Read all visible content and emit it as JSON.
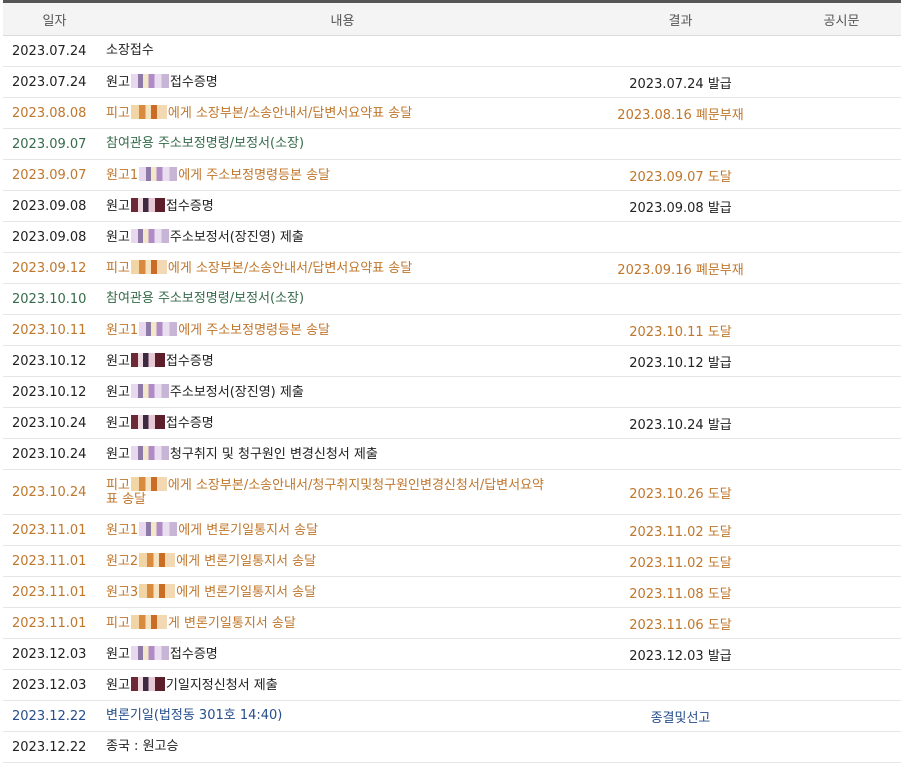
{
  "header": {
    "date": "일자",
    "content": "내용",
    "result": "결과",
    "notice": "공시문"
  },
  "rows": [
    {
      "date": "2023.07.24",
      "content_a": "소장접수",
      "content_b": "",
      "result": "",
      "color": "black",
      "redact": ""
    },
    {
      "date": "2023.07.24",
      "content_a": "원고",
      "content_b": "접수증명",
      "result": "2023.07.24 발급",
      "color": "black",
      "redact": "normal"
    },
    {
      "date": "2023.08.08",
      "content_a": "피고",
      "content_b": "에게 소장부본/소송안내서/답변서요약표 송달",
      "result": "2023.08.16 폐문부재",
      "color": "orange",
      "redact": "warm"
    },
    {
      "date": "2023.09.07",
      "content_a": "참여관용 주소보정명령/보정서(소장)",
      "content_b": "",
      "result": "",
      "color": "green",
      "redact": ""
    },
    {
      "date": "2023.09.07",
      "content_a": "원고1",
      "content_b": "에게 주소보정명령등본 송달",
      "result": "2023.09.07 도달",
      "color": "orange",
      "redact": "normal"
    },
    {
      "date": "2023.09.08",
      "content_a": "원고",
      "content_b": "접수증명",
      "result": "2023.09.08 발급",
      "color": "black",
      "redact": "dark"
    },
    {
      "date": "2023.09.08",
      "content_a": "원고",
      "content_b": "주소보정서(장진영) 제출",
      "result": "",
      "color": "black",
      "redact": "normal"
    },
    {
      "date": "2023.09.12",
      "content_a": "피고",
      "content_b": "에게 소장부본/소송안내서/답변서요약표 송달",
      "result": "2023.09.16 폐문부재",
      "color": "orange",
      "redact": "warm"
    },
    {
      "date": "2023.10.10",
      "content_a": "참여관용 주소보정명령/보정서(소장)",
      "content_b": "",
      "result": "",
      "color": "green",
      "redact": ""
    },
    {
      "date": "2023.10.11",
      "content_a": "원고1",
      "content_b": "에게 주소보정명령등본 송달",
      "result": "2023.10.11 도달",
      "color": "orange",
      "redact": "normal"
    },
    {
      "date": "2023.10.12",
      "content_a": "원고",
      "content_b": "접수증명",
      "result": "2023.10.12 발급",
      "color": "black",
      "redact": "dark"
    },
    {
      "date": "2023.10.12",
      "content_a": "원고",
      "content_b": "주소보정서(장진영) 제출",
      "result": "",
      "color": "black",
      "redact": "normal"
    },
    {
      "date": "2023.10.24",
      "content_a": "원고",
      "content_b": "접수증명",
      "result": "2023.10.24 발급",
      "color": "black",
      "redact": "dark"
    },
    {
      "date": "2023.10.24",
      "content_a": "원고",
      "content_b": "청구취지 및 청구원인 변경신청서 제출",
      "result": "",
      "color": "black",
      "redact": "normal"
    },
    {
      "date": "2023.10.24",
      "content_a": "피고",
      "content_b": "에게 소장부본/소송안내서/청구취지및청구원인변경신청서/답변서요약",
      "content_c": "표 송달",
      "result": "2023.10.26 도달",
      "color": "orange",
      "redact": "warm",
      "tall": true
    },
    {
      "date": "2023.11.01",
      "content_a": "원고1",
      "content_b": "에게 변론기일통지서 송달",
      "result": "2023.11.02 도달",
      "color": "orange",
      "redact": "normal"
    },
    {
      "date": "2023.11.01",
      "content_a": "원고2",
      "content_b": "에게 변론기일통지서 송달",
      "result": "2023.11.02 도달",
      "color": "orange",
      "redact": "warm"
    },
    {
      "date": "2023.11.01",
      "content_a": "원고3",
      "content_b": "에게 변론기일통지서 송달",
      "result": "2023.11.08 도달",
      "color": "orange",
      "redact": "warm"
    },
    {
      "date": "2023.11.01",
      "content_a": "피고",
      "content_b": "게 변론기일통지서 송달",
      "result": "2023.11.06 도달",
      "color": "orange",
      "redact": "warm"
    },
    {
      "date": "2023.12.03",
      "content_a": "원고",
      "content_b": "접수증명",
      "result": "2023.12.03 발급",
      "color": "black",
      "redact": "normal"
    },
    {
      "date": "2023.12.03",
      "content_a": "원고",
      "content_b": "기일지정신청서 제출",
      "result": "",
      "color": "black",
      "redact": "dark"
    },
    {
      "date": "2023.12.22",
      "content_a": "변론기일(법정동 301호 14:40)",
      "content_b": "",
      "result": "종결및선고",
      "color": "blue",
      "redact": ""
    },
    {
      "date": "2023.12.22",
      "content_a": "종국 : 원고승",
      "content_b": "",
      "result": "",
      "color": "black",
      "redact": ""
    }
  ]
}
